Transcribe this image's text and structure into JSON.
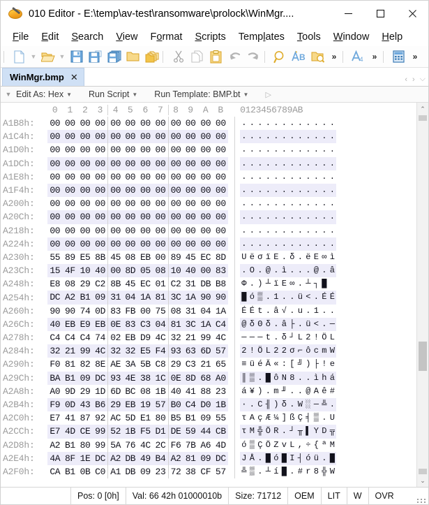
{
  "window": {
    "title": "010 Editor - E:\\temp\\av-test\\ransomware\\prolock\\WinMgr....",
    "icon": "app-logo-icon",
    "minimize_label": "–",
    "maximize_label": "□",
    "close_label": "✕"
  },
  "menubar": {
    "items": [
      {
        "label": "File",
        "mnemonic": "F"
      },
      {
        "label": "Edit",
        "mnemonic": "E"
      },
      {
        "label": "Search",
        "mnemonic": "S"
      },
      {
        "label": "View",
        "mnemonic": "V"
      },
      {
        "label": "Format",
        "mnemonic": "o"
      },
      {
        "label": "Scripts",
        "mnemonic": "S"
      },
      {
        "label": "Templates",
        "mnemonic": "l"
      },
      {
        "label": "Tools",
        "mnemonic": "T"
      },
      {
        "label": "Window",
        "mnemonic": "W"
      },
      {
        "label": "Help",
        "mnemonic": "H"
      }
    ]
  },
  "toolbar": {
    "items": [
      {
        "name": "new-file-icon",
        "title": "New"
      },
      {
        "name": "new-file-dropdown-caret-icon",
        "title": "New options"
      },
      {
        "name": "open-file-icon",
        "title": "Open"
      },
      {
        "name": "open-file-dropdown-caret-icon",
        "title": "Open options"
      },
      {
        "name": "save-icon",
        "title": "Save"
      },
      {
        "name": "save-as-icon",
        "title": "Save As"
      },
      {
        "name": "save-all-icon",
        "title": "Save All"
      },
      {
        "name": "open-folder-icon",
        "title": "Open Directory"
      },
      {
        "name": "open-all-folders-icon",
        "title": "Open All"
      },
      {
        "name": "cut-icon",
        "title": "Cut"
      },
      {
        "name": "copy-icon",
        "title": "Copy"
      },
      {
        "name": "paste-icon",
        "title": "Paste"
      },
      {
        "name": "undo-icon",
        "title": "Undo"
      },
      {
        "name": "redo-icon",
        "title": "Redo"
      },
      {
        "name": "find-icon",
        "title": "Find"
      },
      {
        "name": "replace-icon",
        "title": "Replace"
      },
      {
        "name": "find-in-files-icon",
        "title": "Find In Files"
      },
      {
        "name": "overflow-chevrons-icon",
        "title": "More"
      },
      {
        "name": "font-size-icon",
        "title": "Font"
      },
      {
        "name": "overflow-chevrons-icon-2",
        "title": "More"
      },
      {
        "name": "calculator-icon",
        "title": "Calculator"
      },
      {
        "name": "overflow-chevrons-icon-3",
        "title": "More"
      }
    ],
    "more_glyph": "»"
  },
  "tabs": {
    "items": [
      {
        "label": "WinMgr.bmp",
        "close": "✕",
        "active": true
      }
    ],
    "nav_prev": "‹",
    "nav_next": "›",
    "nav_list": "⌵"
  },
  "editbar": {
    "collapse_glyph": "▼",
    "edit_as_label": "Edit As: Hex",
    "run_script_label": "Run Script",
    "run_template_label": "Run Template: BMP.bt",
    "chevron": "⌄",
    "play_glyph": "▷"
  },
  "hex": {
    "column_headers": [
      "0",
      "1",
      "2",
      "3",
      "4",
      "5",
      "6",
      "7",
      "8",
      "9",
      "A",
      "B"
    ],
    "ascii_header": "0123456789AB",
    "bytes_per_row": 12,
    "rows": [
      {
        "addr": "A1B8h:",
        "bytes": [
          "00",
          "00",
          "00",
          "00",
          "00",
          "00",
          "00",
          "00",
          "00",
          "00",
          "00",
          "00"
        ],
        "ascii": "............"
      },
      {
        "addr": "A1C4h:",
        "bytes": [
          "00",
          "00",
          "00",
          "00",
          "00",
          "00",
          "00",
          "00",
          "00",
          "00",
          "00",
          "00"
        ],
        "ascii": "............"
      },
      {
        "addr": "A1D0h:",
        "bytes": [
          "00",
          "00",
          "00",
          "00",
          "00",
          "00",
          "00",
          "00",
          "00",
          "00",
          "00",
          "00"
        ],
        "ascii": "............"
      },
      {
        "addr": "A1DCh:",
        "bytes": [
          "00",
          "00",
          "00",
          "00",
          "00",
          "00",
          "00",
          "00",
          "00",
          "00",
          "00",
          "00"
        ],
        "ascii": "............"
      },
      {
        "addr": "A1E8h:",
        "bytes": [
          "00",
          "00",
          "00",
          "00",
          "00",
          "00",
          "00",
          "00",
          "00",
          "00",
          "00",
          "00"
        ],
        "ascii": "............"
      },
      {
        "addr": "A1F4h:",
        "bytes": [
          "00",
          "00",
          "00",
          "00",
          "00",
          "00",
          "00",
          "00",
          "00",
          "00",
          "00",
          "00"
        ],
        "ascii": "............"
      },
      {
        "addr": "A200h:",
        "bytes": [
          "00",
          "00",
          "00",
          "00",
          "00",
          "00",
          "00",
          "00",
          "00",
          "00",
          "00",
          "00"
        ],
        "ascii": "............"
      },
      {
        "addr": "A20Ch:",
        "bytes": [
          "00",
          "00",
          "00",
          "00",
          "00",
          "00",
          "00",
          "00",
          "00",
          "00",
          "00",
          "00"
        ],
        "ascii": "............"
      },
      {
        "addr": "A218h:",
        "bytes": [
          "00",
          "00",
          "00",
          "00",
          "00",
          "00",
          "00",
          "00",
          "00",
          "00",
          "00",
          "00"
        ],
        "ascii": "............"
      },
      {
        "addr": "A224h:",
        "bytes": [
          "00",
          "00",
          "00",
          "00",
          "00",
          "00",
          "00",
          "00",
          "00",
          "00",
          "00",
          "00"
        ],
        "ascii": "............"
      },
      {
        "addr": "A230h:",
        "bytes": [
          "55",
          "89",
          "E5",
          "8B",
          "45",
          "08",
          "EB",
          "00",
          "89",
          "45",
          "EC",
          "8D"
        ],
        "ascii": "UëσïE.δ.ëE∞ì"
      },
      {
        "addr": "A23Ch:",
        "bytes": [
          "15",
          "4F",
          "10",
          "40",
          "00",
          "8D",
          "05",
          "08",
          "10",
          "40",
          "00",
          "83"
        ],
        "ascii": ".O.@.ì...@.â"
      },
      {
        "addr": "A248h:",
        "bytes": [
          "E8",
          "08",
          "29",
          "C2",
          "8B",
          "45",
          "EC",
          "01",
          "C2",
          "31",
          "DB",
          "B8"
        ],
        "ascii": "Φ.)┴ïE∞.┴┐█"
      },
      {
        "addr": "A254h:",
        "bytes": [
          "DC",
          "A2",
          "B1",
          "09",
          "31",
          "04",
          "1A",
          "81",
          "3C",
          "1A",
          "90",
          "90"
        ],
        "ascii": "█ó▒.1..ü<.ÉÉ"
      },
      {
        "addr": "A260h:",
        "bytes": [
          "90",
          "90",
          "74",
          "0D",
          "83",
          "FB",
          "00",
          "75",
          "08",
          "31",
          "04",
          "1A"
        ],
        "ascii": "ÉÉt.â√.u.1.."
      },
      {
        "addr": "A26Ch:",
        "bytes": [
          "40",
          "EB",
          "E9",
          "EB",
          "0E",
          "83",
          "C3",
          "04",
          "81",
          "3C",
          "1A",
          "C4"
        ],
        "ascii": "@δΘδ.â├.ü<.─"
      },
      {
        "addr": "A278h:",
        "bytes": [
          "C4",
          "C4",
          "C4",
          "74",
          "02",
          "EB",
          "D9",
          "4C",
          "32",
          "21",
          "99",
          "4C"
        ],
        "ascii": "───t.δ┘L2!ÖL"
      },
      {
        "addr": "A284h:",
        "bytes": [
          "32",
          "21",
          "99",
          "4C",
          "32",
          "32",
          "E5",
          "F4",
          "93",
          "63",
          "6D",
          "57"
        ],
        "ascii": "2!ÖL22σ⌐ôcmW"
      },
      {
        "addr": "A290h:",
        "bytes": [
          "F0",
          "81",
          "82",
          "8E",
          "AE",
          "3A",
          "5B",
          "C8",
          "29",
          "C3",
          "21",
          "65"
        ],
        "ascii": "≡üéÄ«:[╝)├!e"
      },
      {
        "addr": "A29Ch:",
        "bytes": [
          "BA",
          "B1",
          "09",
          "DC",
          "93",
          "4E",
          "38",
          "1C",
          "0E",
          "8D",
          "68",
          "A0"
        ],
        "ascii": "║▒.█ôN8..ìhá"
      },
      {
        "addr": "A2A8h:",
        "bytes": [
          "A0",
          "9D",
          "29",
          "1D",
          "6D",
          "BC",
          "08",
          "1B",
          "40",
          "41",
          "88",
          "23"
        ],
        "ascii": "á¥).m╜..@Aê#"
      },
      {
        "addr": "A2B4h:",
        "bytes": [
          "F9",
          "0D",
          "43",
          "B6",
          "29",
          "EB",
          "19",
          "57",
          "B0",
          "C4",
          "D0",
          "1B"
        ],
        "ascii": "·.C╢)δ.W░─╩."
      },
      {
        "addr": "A2C0h:",
        "bytes": [
          "E7",
          "41",
          "87",
          "92",
          "AC",
          "5D",
          "E1",
          "80",
          "B5",
          "B1",
          "09",
          "55"
        ],
        "ascii": "τAçÆ¼]ßÇ╡▒.U"
      },
      {
        "addr": "A2CCh:",
        "bytes": [
          "E7",
          "4D",
          "CE",
          "99",
          "52",
          "1B",
          "F5",
          "D1",
          "DE",
          "59",
          "44",
          "CB"
        ],
        "ascii": "τM╬ÖR.┘╥▌YD╦"
      },
      {
        "addr": "A2D8h:",
        "bytes": [
          "A2",
          "B1",
          "80",
          "99",
          "5A",
          "76",
          "4C",
          "2C",
          "F6",
          "7B",
          "A6",
          "4D"
        ],
        "ascii": "ó▒ÇÖZvL,÷{ªM"
      },
      {
        "addr": "A2E4h:",
        "bytes": [
          "4A",
          "8F",
          "1E",
          "DC",
          "A2",
          "DB",
          "49",
          "B4",
          "A2",
          "81",
          "09",
          "DC"
        ],
        "ascii": "JÅ.█ó█I┤óü.█"
      },
      {
        "addr": "A2F0h:",
        "bytes": [
          "CA",
          "B1",
          "0B",
          "C0",
          "A1",
          "DB",
          "09",
          "23",
          "72",
          "38",
          "CF",
          "57"
        ],
        "ascii": "╩▒.┴í█.#r8╬W"
      }
    ]
  },
  "scrollbar": {
    "up_glyph": "⌃",
    "down_glyph": "⌄"
  },
  "statusbar": {
    "position": "Pos: 0 [0h]",
    "value": "Val: 66 42h 01000010b",
    "size": "Size: 71712",
    "charset": "OEM",
    "endian": "LIT",
    "mode_w": "W",
    "insert_mode": "OVR"
  },
  "colors": {
    "tab_active_bg": "#cfe0f5",
    "alt_row_bg": "#edecf9",
    "address_fg": "#9b9b9b",
    "hex_fg": "#12121c",
    "toolbar_yellow": "#f2c44a",
    "toolbar_blue": "#6ea8dc"
  }
}
